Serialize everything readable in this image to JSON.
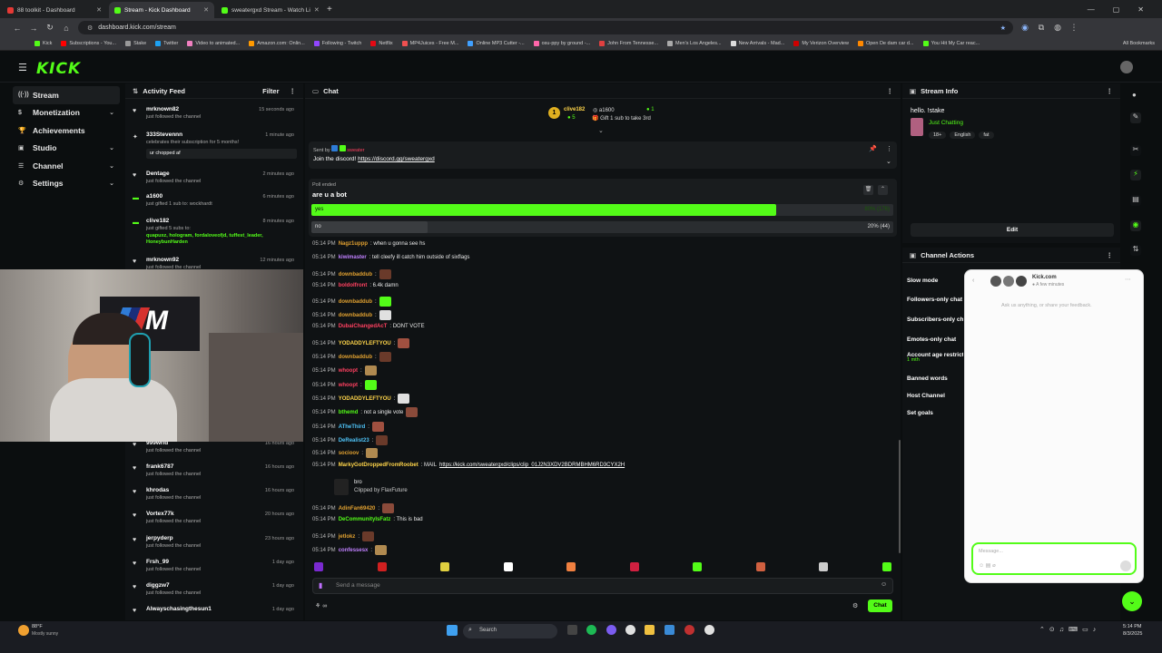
{
  "browser": {
    "tabs": [
      {
        "title": "88 toolkit - Dashboard",
        "color": "#e53935"
      },
      {
        "title": "Stream - Kick Dashboard",
        "color": "#53fc18"
      },
      {
        "title": "sweatergxd Stream - Watch Li",
        "color": "#53fc18"
      }
    ],
    "url": "dashboard.kick.com/stream",
    "bookmarks": [
      "Kick",
      "Subscriptions - You...",
      "Stake",
      "Twitter",
      "Video to animated...",
      "Amazon.com: Onlin...",
      "Following - Twitch",
      "Netflix",
      "MP4Juices - Free M...",
      "Online MP3 Cutter -...",
      "osu-ppy by ground -...",
      "John From Tennesse...",
      "Men's Los Angeles...",
      "New Arrivals - Mad...",
      "My Verizon Overview",
      "Open De dam car d...",
      "You Hit My Car reac..."
    ],
    "all_bookmarks": "All Bookmarks"
  },
  "logo": "KICK",
  "nav": [
    {
      "label": "Stream",
      "chev": false
    },
    {
      "label": "Monetization",
      "chev": true
    },
    {
      "label": "Achievements",
      "chev": false
    },
    {
      "label": "Studio",
      "chev": true
    },
    {
      "label": "Channel",
      "chev": true
    },
    {
      "label": "Settings",
      "chev": true
    }
  ],
  "activity": {
    "title": "Activity Feed",
    "filter": "Filter",
    "items": [
      {
        "name": "mrknown82",
        "text": "just followed the channel",
        "time": "15 seconds ago",
        "extra": ""
      },
      {
        "name": "333Stevennn",
        "text": "celebrates their subscription for 5 months!",
        "time": "1 minute ago",
        "extra": "ur chopped af"
      },
      {
        "name": "Dentage",
        "text": "just followed the channel",
        "time": "2 minutes ago",
        "extra": ""
      },
      {
        "name": "a1600",
        "text": "just gifted 1 sub to: wockhardt",
        "time": "6 minutes ago",
        "extra": ""
      },
      {
        "name": "clive182",
        "text": "just gifted 5 subs to:",
        "time": "8 minutes ago",
        "extra": "quapuxz, hologram, fordaloveofjd, tuffest_leader, HoneybunHarden"
      },
      {
        "name": "mrknown92",
        "text": "just followed the channel",
        "time": "12 minutes ago",
        "extra": ""
      },
      {
        "name": "999wrld",
        "text": "just followed the channel",
        "time": "16 hours ago",
        "extra": ""
      },
      {
        "name": "frank6787",
        "text": "just followed the channel",
        "time": "16 hours ago",
        "extra": ""
      },
      {
        "name": "khrodas",
        "text": "just followed the channel",
        "time": "16 hours ago",
        "extra": ""
      },
      {
        "name": "Vortex77k",
        "text": "just followed the channel",
        "time": "20 hours ago",
        "extra": ""
      },
      {
        "name": "jerpyderp",
        "text": "just followed the channel",
        "time": "23 hours ago",
        "extra": ""
      },
      {
        "name": "Frsh_99",
        "text": "just followed the channel",
        "time": "1 day ago",
        "extra": ""
      },
      {
        "name": "diggzw7",
        "text": "just followed the channel",
        "time": "1 day ago",
        "extra": ""
      },
      {
        "name": "Alwayschasingthesun1",
        "text": "",
        "time": "1 day ago",
        "extra": ""
      }
    ]
  },
  "chat": {
    "title": "Chat",
    "gift_user": "clive182",
    "gift_count": "5",
    "gift_user2": "a1600",
    "gift_count2": "1",
    "gift_text": "Gift 1 sub to take 3rd",
    "pinned_sent_by": "Sent by",
    "pinned_text": "Join the discord!",
    "pinned_link": "https://discord.gg/sweatergxd",
    "poll_status": "Poll ended",
    "poll_question": "are u a bot",
    "poll_options": [
      {
        "label": "yes",
        "result": "80% (176)",
        "pct": 80
      },
      {
        "label": "no",
        "result": "20% (44)",
        "pct": 20
      }
    ],
    "messages": [
      {
        "time": "05:14 PM",
        "user": "Nagz1uppp",
        "color": "#e0a030",
        "text": ": when u gonna see hs",
        "emote": false
      },
      {
        "time": "05:14 PM",
        "user": "kiwimaster",
        "color": "#c080ff",
        "text": ": tell cleefy ill catch him outside of sixflags",
        "emote": false
      },
      {
        "time": "05:14 PM",
        "user": "downbaddub",
        "color": "#e0a030",
        "text": ":",
        "emote": true
      },
      {
        "time": "05:14 PM",
        "user": "boldolfront",
        "color": "#ff4060",
        "text": ": 6.4k damn",
        "emote": false
      },
      {
        "time": "05:14 PM",
        "user": "downbaddub",
        "color": "#e0a030",
        "text": ":",
        "emote": true
      },
      {
        "time": "05:14 PM",
        "user": "downbaddub",
        "color": "#e0a030",
        "text": ":",
        "emote": true
      },
      {
        "time": "05:14 PM",
        "user": "DubaiChangedAcT",
        "color": "#ff4060",
        "text": ": DONT VOTE",
        "emote": false
      },
      {
        "time": "05:14 PM",
        "user": "YODADDYLEFTYOU",
        "color": "#ffd54a",
        "text": ":",
        "emote": true
      },
      {
        "time": "05:14 PM",
        "user": "downbaddub",
        "color": "#e0a030",
        "text": ":",
        "emote": true
      },
      {
        "time": "05:14 PM",
        "user": "whoopt",
        "color": "#ff4060",
        "text": ":",
        "emote": true
      },
      {
        "time": "05:14 PM",
        "user": "whoopt",
        "color": "#ff4060",
        "text": ":",
        "emote": true
      },
      {
        "time": "05:14 PM",
        "user": "YODADDYLEFTYOU",
        "color": "#ffd54a",
        "text": ":",
        "emote": true
      },
      {
        "time": "05:14 PM",
        "user": "bthemd",
        "color": "#53fc18",
        "text": ": not a single vote",
        "emote": true
      },
      {
        "time": "05:14 PM",
        "user": "ATheThird",
        "color": "#4fc3f7",
        "text": ":",
        "emote": true
      },
      {
        "time": "05:14 PM",
        "user": "DeRealist23",
        "color": "#4fc3f7",
        "text": ":",
        "emote": true
      },
      {
        "time": "05:14 PM",
        "user": "socioov",
        "color": "#e0a030",
        "text": ":",
        "emote": true
      },
      {
        "time": "05:14 PM",
        "user": "MarkyGotDroppedFromRoobet",
        "color": "#ffd54a",
        "text": ": MAIL",
        "emote": false,
        "link": "https://kick.com/sweatergxd/clips/clip_01J2N3XDV2BDRMBHM6RD3CYX2H"
      },
      {
        "time": "",
        "user": "",
        "color": "#e8e8e8",
        "text": "bro",
        "emote": false,
        "clip": "Clipped by FlaxFuture"
      },
      {
        "time": "05:14 PM",
        "user": "AdinFan69420",
        "color": "#e0a030",
        "text": ":",
        "emote": true
      },
      {
        "time": "05:14 PM",
        "user": "DeCommunityIsFatz",
        "color": "#53fc18",
        "text": ": This is bad",
        "emote": false
      },
      {
        "time": "05:14 PM",
        "user": "jetlokz",
        "color": "#e0a030",
        "text": ":",
        "emote": true
      },
      {
        "time": "05:14 PM",
        "user": "confessesx",
        "color": "#c080ff",
        "text": ":",
        "emote": true
      }
    ],
    "placeholder": "Send a message",
    "send": "Chat"
  },
  "stream_info": {
    "title": "Stream Info",
    "stream_title": "hello. !stake",
    "category": "Just Chatting",
    "tags": [
      "18+",
      "English",
      "fat"
    ],
    "edit": "Edit"
  },
  "channel_actions": {
    "title": "Channel Actions",
    "items": [
      "Slow mode",
      "Followers-only chat",
      "Subscribers-only chat",
      "Emotes-only chat",
      "Account age restriction",
      "Banned words",
      "Host Channel",
      "Set goals"
    ],
    "age_value": "1 mth"
  },
  "feedback": {
    "site": "Kick.com",
    "time": "A few minutes",
    "prompt": "Ask us anything, or share your feedback.",
    "placeholder": "Message..."
  },
  "taskbar": {
    "weather_temp": "88°F",
    "weather_desc": "Mostly sunny",
    "search": "Search",
    "time": "5:14 PM",
    "date": "8/3/2025"
  }
}
